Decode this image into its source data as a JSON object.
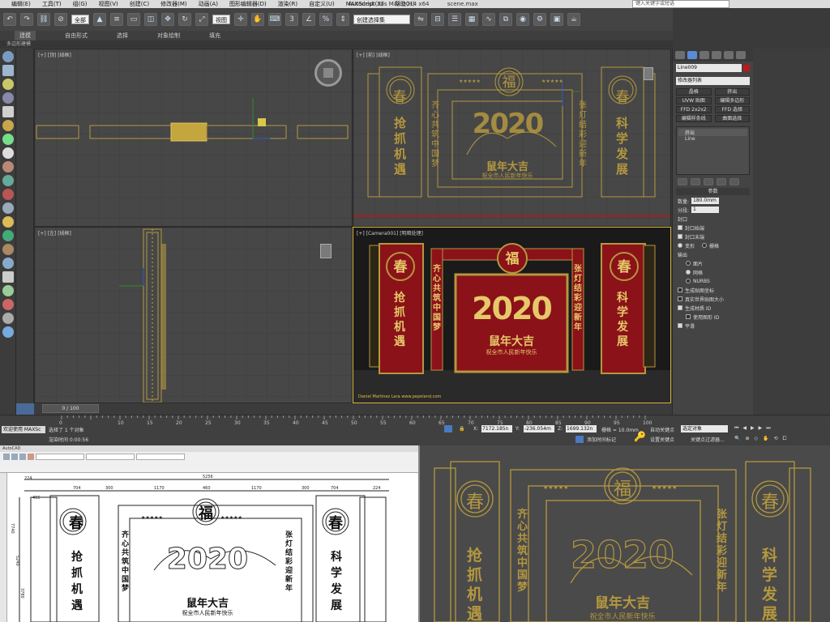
{
  "app": {
    "title": "Autodesk 3ds Max 2014 x64",
    "file": "scene.max",
    "right_search": "键入关键字或短语"
  },
  "menu": [
    "编辑(E)",
    "工具(T)",
    "组(G)",
    "视图(V)",
    "创建(C)",
    "修改器(M)",
    "动画(A)",
    "图形编辑器(D)",
    "渲染(R)",
    "自定义(U)",
    "MAXScript(X)",
    "帮助(H)"
  ],
  "toolbar": {
    "selection_filter": "全部",
    "ref_coord": "视图",
    "named_set": "创建选择集"
  },
  "ribbon": {
    "tabs": [
      "建模",
      "自由形式",
      "选择",
      "对象绘制",
      "填充"
    ],
    "subtitle": "多边形建模"
  },
  "viewports": {
    "top_left_label": "[+] [顶] [线框]",
    "top_right_label": "[+] [前] [线框]",
    "bottom_left_label": "[+] [左] [线框]",
    "bottom_right_label": "[+] [Camera001] [明暗处理]",
    "credit": "Daniel Martinez Lara   www.pepeland.com"
  },
  "design": {
    "left_badge": "春",
    "center_badge": "福",
    "right_badge": "春",
    "left_banner": "抢抓机遇",
    "right_banner": "科学发展",
    "inner_left": "齐心共筑中国梦",
    "inner_right": "张灯结彩迎新年",
    "year": "2020",
    "headline": "鼠年大吉",
    "subline": "祝全市人民新年快乐",
    "stars": "★★★★★"
  },
  "command_panel": {
    "object_name": "Line009",
    "modifier_list": "修改器列表",
    "buttons": [
      "晶格",
      "挤出",
      "UVW 贴图",
      "编辑多边形",
      "FFD 2x2x2",
      "FFD 选择",
      "编辑样条线",
      "曲面选择"
    ],
    "stack": [
      "挤出",
      "Line"
    ],
    "params_title": "参数",
    "amount_label": "数量:",
    "amount_value": "180.0mm",
    "segments_label": "分段:",
    "segments_value": "1",
    "cap_title": "封口",
    "cap_start": "封口始端",
    "cap_end": "封口末端",
    "morph": "变形",
    "grid": "栅格",
    "output_title": "输出",
    "patch": "面片",
    "mesh": "网格",
    "nurbs": "NURBS",
    "gen_map": "生成贴图坐标",
    "real_world": "真实世界贴图大小",
    "gen_mat": "生成材质 ID",
    "use_shape": "使用图形 ID",
    "smooth": "平滑"
  },
  "timeline": {
    "frame": "0 / 100",
    "ticks": [
      "0",
      "10",
      "15",
      "20",
      "25",
      "30",
      "35",
      "40",
      "45",
      "50",
      "55",
      "60",
      "65",
      "70",
      "75",
      "80",
      "85",
      "90",
      "95",
      "100"
    ]
  },
  "status": {
    "selected": "选择了 1 个对象",
    "render_time": "渲染时间 0:00:56",
    "welcome": "欢迎使用 MAXSc",
    "x_label": "X:",
    "x": "7172.185n",
    "y_label": "Y:",
    "y": "-236.054m",
    "z_label": "Z:",
    "z": "1699.132n",
    "grid": "栅格 = 10.0mm",
    "autokey": "自动关键点",
    "selected_obj": "选定对象",
    "setkey": "设置关键点",
    "keyfilter": "关键点过滤器...",
    "addtime": "添加时间标记"
  },
  "cad": {
    "app": "AutoCAD",
    "dims_top": [
      "224",
      "704",
      "300",
      "1170",
      "460",
      "1170",
      "300",
      "704",
      "224"
    ],
    "overall": "5256",
    "sub_dim": "495",
    "side_dims": [
      "7740",
      "5240",
      "3780"
    ]
  },
  "colors": {
    "gold": "#b4973f",
    "red": "#8b1219",
    "accent": "#d7b33a"
  }
}
